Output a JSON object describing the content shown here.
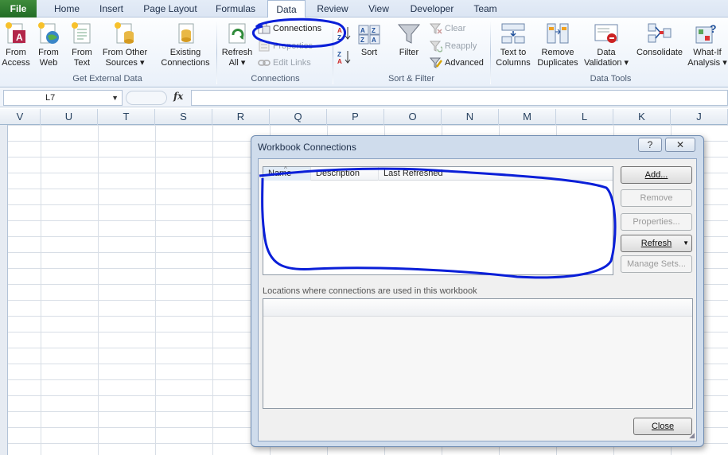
{
  "tabs": [
    "File",
    "Home",
    "Insert",
    "Page Layout",
    "Formulas",
    "Data",
    "Review",
    "View",
    "Developer",
    "Team"
  ],
  "ribbon": {
    "get_external": {
      "label": "Get External Data",
      "from_access": [
        "From",
        "Access"
      ],
      "from_web": [
        "From",
        "Web"
      ],
      "from_text": [
        "From",
        "Text"
      ],
      "from_other": [
        "From Other",
        "Sources ▾"
      ],
      "existing": [
        "Existing",
        "Connections"
      ]
    },
    "connections": {
      "label": "Connections",
      "refresh_all": [
        "Refresh",
        "All ▾"
      ],
      "connections": "Connections",
      "properties": "Properties",
      "edit_links": "Edit Links"
    },
    "sort_filter": {
      "label": "Sort & Filter",
      "sort": "Sort",
      "filter": "Filter",
      "clear": "Clear",
      "reapply": "Reapply",
      "advanced": "Advanced"
    },
    "data_tools": {
      "label": "Data Tools",
      "text_to_columns": [
        "Text to",
        "Columns"
      ],
      "remove_duplicates": [
        "Remove",
        "Duplicates"
      ],
      "data_validation": [
        "Data",
        "Validation ▾"
      ],
      "consolidate": "Consolidate",
      "what_if": [
        "What-If",
        "Analysis ▾"
      ]
    }
  },
  "formula_bar": {
    "name_box": "L7",
    "fx": "fx",
    "value": ""
  },
  "columns": [
    "V",
    "U",
    "T",
    "S",
    "R",
    "Q",
    "P",
    "O",
    "N",
    "M",
    "L",
    "K",
    "J"
  ],
  "dialog": {
    "title": "Workbook Connections",
    "help": "?",
    "close_x": "✕",
    "list_headers": [
      "Name",
      "Description",
      "Last Refreshed"
    ],
    "rows": [],
    "buttons": {
      "add": "Add...",
      "remove": "Remove",
      "properties": "Properties...",
      "refresh": "Refresh",
      "manage_sets": "Manage Sets...",
      "close": "Close"
    },
    "locations_label": "Locations where connections are used in this workbook"
  },
  "colors": {
    "annotation": "#0a1fd8",
    "file_tab": "#2e7d32",
    "dialog_frame": "#cfdcec"
  }
}
